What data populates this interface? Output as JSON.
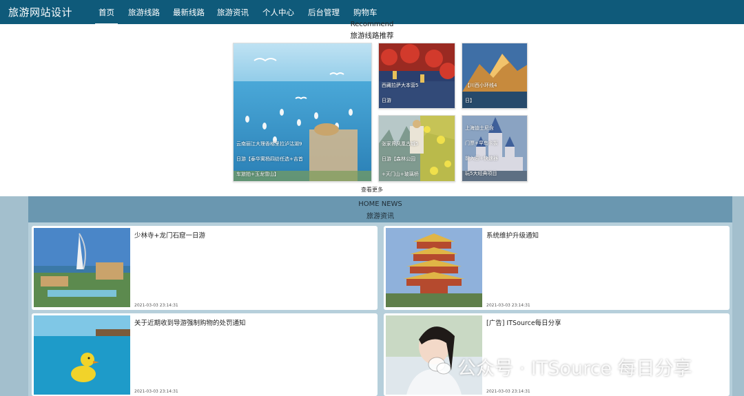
{
  "nav": {
    "brand": "旅游网站设计",
    "items": [
      {
        "label": "首页"
      },
      {
        "label": "旅游线路"
      },
      {
        "label": "最新线路"
      },
      {
        "label": "旅游资讯"
      },
      {
        "label": "个人中心"
      },
      {
        "label": "后台管理"
      },
      {
        "label": "购物车"
      }
    ]
  },
  "recommend": {
    "title_en": "Recommend",
    "title_cn": "旅游线路推荐",
    "tiles": [
      {
        "lines": [
          "云南丽江大理香格里拉泸沽湖9",
          "日游【泰华寓杨四纺任选+吉首",
          "车旅拍+玉龙雪山】"
        ]
      },
      {
        "lines": [
          "西藏拉萨大本营5",
          "日游"
        ]
      },
      {
        "lines": [
          "【川西小环线4",
          "日】"
        ]
      },
      {
        "lines": [
          "张家界凤凰古城5",
          "日游【森林公园",
          "+天门山+玻璃桥"
        ]
      },
      {
        "lines": [
          "上海迪士尼含",
          "门票+早鸟卡拔",
          "前入园+快速器",
          "玩5大经典项目"
        ]
      }
    ],
    "more_label": "查看更多"
  },
  "news": {
    "title_en": "HOME NEWS",
    "title_cn": "旅游资讯",
    "items": [
      {
        "title": "少林寺+龙门石窟一日游",
        "date": "2021-03-03 23:14:31"
      },
      {
        "title": "系统维护升级通知",
        "date": "2021-03-03 23:14:31"
      },
      {
        "title": "关于近期收到导游强制购物的处罚通知",
        "date": "2021-03-03 23:14:31"
      },
      {
        "title": "[广告] ITSource每日分享",
        "date": "2021-03-03 23:14:31"
      }
    ]
  },
  "watermark": "公众号 · ITSource 每日分享"
}
